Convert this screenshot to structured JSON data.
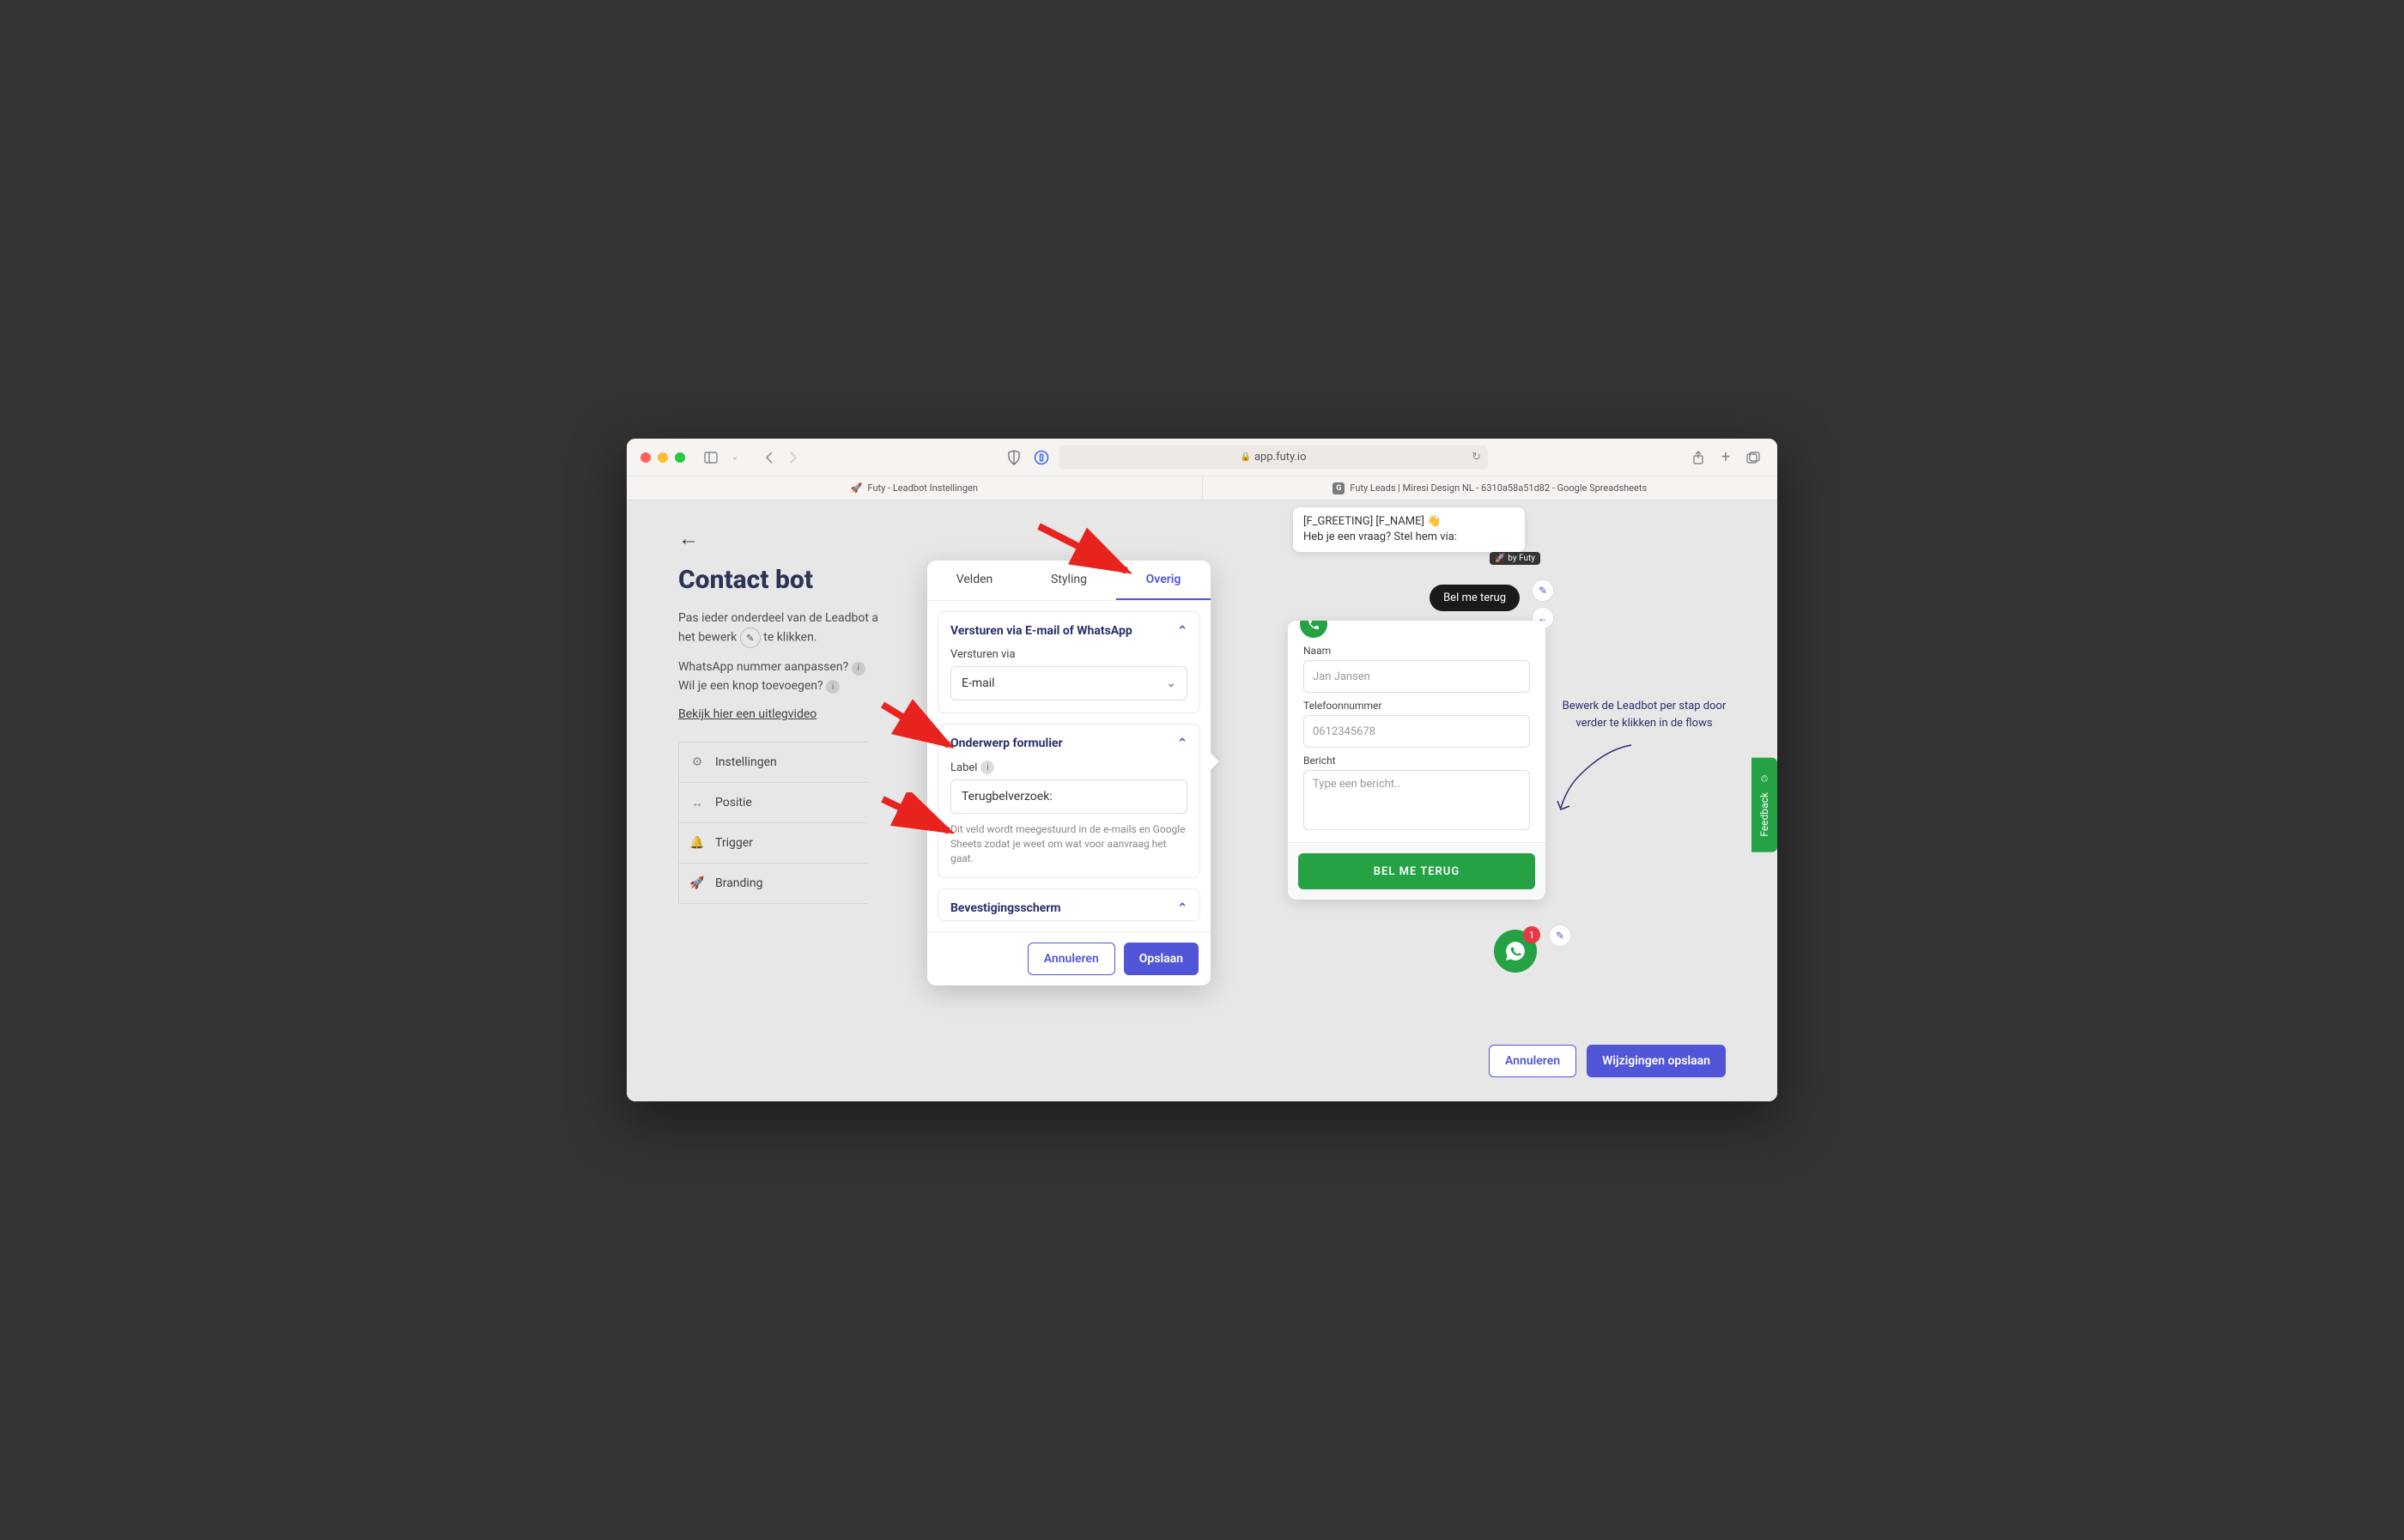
{
  "browser": {
    "url_host": "app.futy.io",
    "tabs": [
      {
        "title": "Futy - Leadbot Instellingen"
      },
      {
        "title": "Futy Leads | Miresi Design NL - 6310a58a51d82 - Google Spreadsheets"
      }
    ]
  },
  "page": {
    "title": "Contact bot",
    "description_part1": "Pas ieder onderdeel van de Leadbot a",
    "description_part2": "het bewerk",
    "description_part3": "te klikken.",
    "question1": "WhatsApp nummer aanpassen?",
    "question2": "Wil je een knop toevoegen?",
    "video_link": "Bekijk hier een uitlegvideo",
    "nav": [
      {
        "label": "Instellingen"
      },
      {
        "label": "Positie"
      },
      {
        "label": "Trigger"
      },
      {
        "label": "Branding"
      }
    ]
  },
  "modal": {
    "tabs": {
      "velden": "Velden",
      "styling": "Styling",
      "overig": "Overig"
    },
    "section1": {
      "title": "Versturen via E-mail of WhatsApp",
      "field_label": "Versturen via",
      "field_value": "E-mail"
    },
    "section2": {
      "title": "Onderwerp formulier",
      "field_label": "Label",
      "field_value": "Terugbelverzoek:",
      "hint": "Dit veld wordt meegestuurd in de e-mails en Google Sheets zodat je weet om wat voor aanvraag het gaat."
    },
    "section3": {
      "title": "Bevestigingsscherm"
    },
    "cancel": "Annuleren",
    "save": "Opslaan"
  },
  "chat": {
    "bubble_line1": "[F_GREETING] [F_NAME] 👋",
    "bubble_line2": "Heb je een vraag? Stel hem via:",
    "by_futy": "🚀 by Futy",
    "callback_pill": "Bel me terug",
    "form": {
      "name_label": "Naam",
      "name_placeholder": "Jan Jansen",
      "phone_label": "Telefoonnummer",
      "phone_placeholder": "0612345678",
      "message_label": "Bericht",
      "message_placeholder": "Type een bericht..",
      "submit": "BEL ME TERUG"
    },
    "fab_badge": "1"
  },
  "help": {
    "text": "Bewerk de Leadbot per stap door verder te klikken in de flows"
  },
  "feedback_tab": "Feedback",
  "bottom": {
    "cancel": "Annuleren",
    "save": "Wijzigingen opslaan"
  }
}
